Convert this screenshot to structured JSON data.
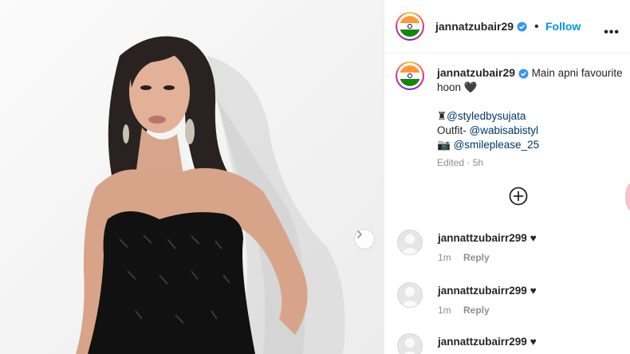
{
  "post": {
    "username": "jannatzubair29",
    "follow_label": "Follow",
    "separator": "•",
    "more_label": "•••",
    "caption_line1": "Main apni favourite",
    "caption_line2": "hoon 🖤",
    "stylist_icon": "♜",
    "mention_stylist": "@styledbysujata",
    "outfit_prefix": "Outfit- ",
    "mention_outfit": "@wabisabistyl",
    "camera_icon": "📷",
    "mention_photo": "@smileplease_25",
    "edited": "Edited · 5h",
    "add_icon": "plus-circle-icon"
  },
  "comments": [
    {
      "username": "jannattzubairr299",
      "text": "♥",
      "time": "1m",
      "reply": "Reply"
    },
    {
      "username": "jannattzubairr299",
      "text": "♥",
      "time": "1m",
      "reply": "Reply"
    },
    {
      "username": "jannattzubairr299",
      "text": "♥",
      "time": "",
      "reply": ""
    }
  ],
  "colors": {
    "accent": "#0095f6",
    "mention": "#00376b",
    "muted": "#8e8e8e",
    "verified": "#3897f0"
  },
  "icons": {
    "verified": "verified-badge-icon",
    "next": "chevron-right-icon",
    "avatar_default": "default-avatar-icon"
  }
}
